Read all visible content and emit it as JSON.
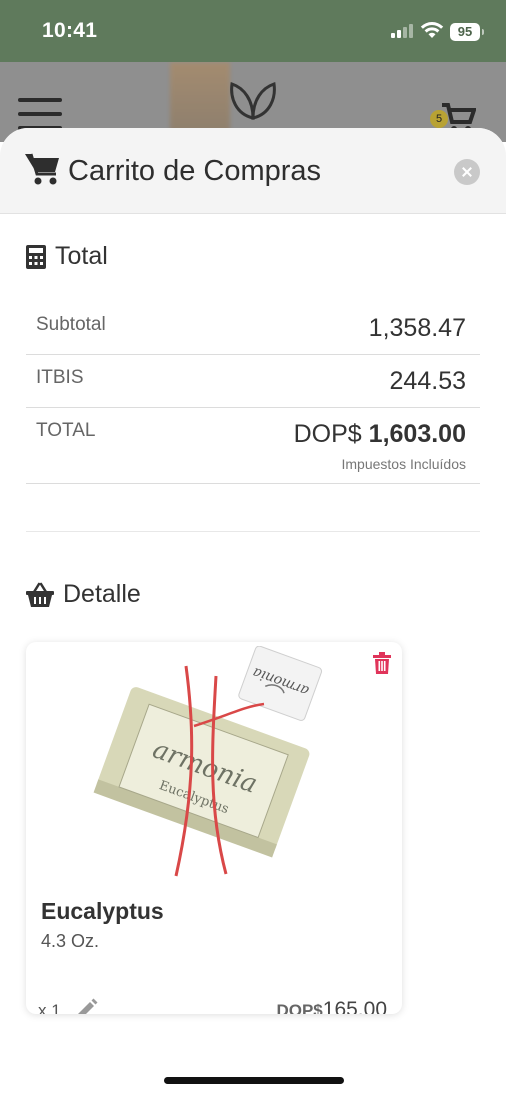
{
  "status_bar": {
    "time": "10:41",
    "battery": "95"
  },
  "background": {
    "cart_count": "5"
  },
  "sheet": {
    "title": "Carrito de Compras",
    "total_section": {
      "heading": "Total",
      "subtotal_label": "Subtotal",
      "subtotal_value": "1,358.47",
      "itbis_label": "ITBIS",
      "itbis_value": "244.53",
      "total_label": "TOTAL",
      "total_currency": "DOP$",
      "total_value": "1,603.00",
      "tax_note": "Impuestos Incluídos"
    },
    "detail_section": {
      "heading": "Detalle",
      "items": [
        {
          "name": "Eucalyptus",
          "size": "4.3 Oz.",
          "quantity": "x 1",
          "currency": "DOP$",
          "price": "165.00",
          "image_brand": "armonia",
          "image_label": "Eucalyptus"
        }
      ]
    }
  },
  "colors": {
    "status_bar": "#5f7a5c",
    "delete_icon": "#e0345a",
    "header_bg": "#f4f4f4"
  }
}
